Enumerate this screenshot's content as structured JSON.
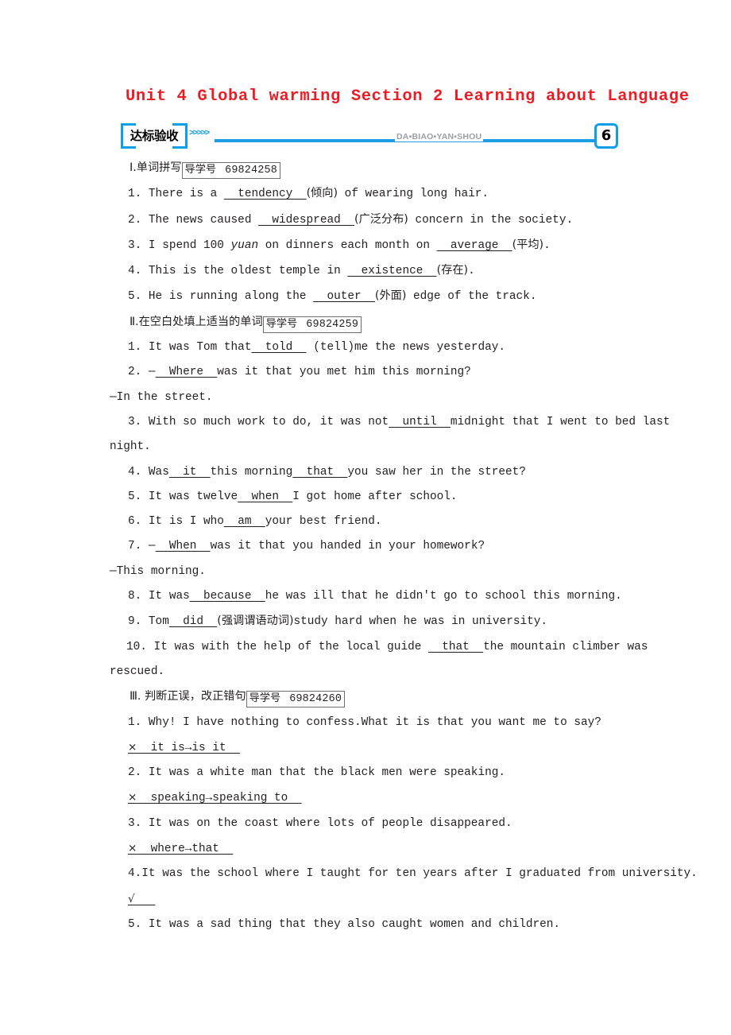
{
  "document": {
    "title": "Unit 4 Global warming Section 2 Learning about Language",
    "title_color": "#ec1c24"
  },
  "banner": {
    "label_cn": "达标验收",
    "chevrons": ">>>>>",
    "pinyin": "DA▪BIAO▪YAN▪SHOU",
    "badge": "6",
    "accent_color": "#0e9fe8"
  },
  "sections": [
    {
      "numeral": "Ⅰ",
      "heading_cn": ".单词拼写",
      "tag_label": "导学号",
      "tag_number": "69824258",
      "items": [
        {
          "num": "1.",
          "pre": " There is a ",
          "blank": "  tendency  ",
          "hint": "(倾向)",
          "post": " of wearing long hair."
        },
        {
          "num": "2.",
          "pre": " The news caused ",
          "blank": "  widespread  ",
          "hint": "(广泛分布)",
          "post": " concern in the society."
        },
        {
          "num": "3.",
          "pre": " I spend 100 ",
          "italic": "yuan",
          "pre2": " on dinners each month on ",
          "blank": "  average  ",
          "hint": "(平均)",
          "post": "."
        },
        {
          "num": "4.",
          "pre": " This is the oldest temple in ",
          "blank": "  existence  ",
          "hint": "(存在)",
          "post": "."
        },
        {
          "num": "5.",
          "pre": " He is running along the ",
          "blank": "  outer  ",
          "hint": "(外面)",
          "post": " edge of the track."
        }
      ]
    },
    {
      "numeral": "Ⅱ",
      "heading_cn": ".在空白处填上适当的单词",
      "tag_label": "导学号",
      "tag_number": "69824259",
      "items": [
        {
          "num": "1.",
          "pre": " It was Tom that",
          "blank": "  told  ",
          "post": " (tell)me the news yesterday."
        },
        {
          "num": "2.",
          "pre": " —",
          "blank": "  Where  ",
          "post": "was it that you met him this morning?"
        },
        {
          "continuation": "—In the street."
        },
        {
          "num": "3.",
          "pre": " With so much work to do, it  was not",
          "blank": "  until  ",
          "post": "midnight that I went to bed last",
          "wrap": "night."
        },
        {
          "num": "4.",
          "pre": " Was",
          "blank": "  it  ",
          "mid": "this morning",
          "blank2": "  that  ",
          "post": "you saw her in the street?"
        },
        {
          "num": "5.",
          "pre": " It was twelve",
          "blank": "  when  ",
          "post": "I got home after school."
        },
        {
          "num": "6.",
          "pre": " It is I who",
          "blank": "  am  ",
          "post": "your best friend."
        },
        {
          "num": "7.",
          "pre": " —",
          "blank": "  When  ",
          "post": "was it that you handed in your homework?"
        },
        {
          "continuation": "—This morning."
        },
        {
          "num": "8.",
          "pre": " It was",
          "blank": "  because  ",
          "post": "he was ill that he didn't go to school this morning."
        },
        {
          "num": "9.",
          "pre": " Tom",
          "blank": "  did  ",
          "hint": "(强调谓语动词)",
          "post": "study hard when he was in university."
        },
        {
          "num": "10.",
          "pre": " It was with the help of the local guide ",
          "blank": "  that  ",
          "post": "the mountain climber was",
          "wrap": "rescued."
        }
      ]
    },
    {
      "numeral": "Ⅲ",
      "heading_cn": ". 判断正误，改正错句",
      "tag_label": "导学号",
      "tag_number": "69824260",
      "items": [
        {
          "num": "1.",
          "sentence": " Why! I have nothing to confess.What it is that you want me to say?",
          "answer_mark": "×",
          "answer_text": "  it is→is it  "
        },
        {
          "num": "2.",
          "sentence": " It was a white man that the black men were speaking.",
          "answer_mark": "×",
          "answer_text": "  speaking→speaking to  "
        },
        {
          "num": "3.",
          "sentence": " It was on the coast where lots of people disappeared.",
          "answer_mark": "×",
          "answer_text": "  where→that  "
        },
        {
          "num": "4.",
          "sentence": "It was the school where I taught for ten years after I graduated from university.",
          "answer_mark": "√",
          "answer_text": "   "
        },
        {
          "num": "5.",
          "sentence": " It was a sad thing that they also caught women and children."
        }
      ]
    }
  ]
}
